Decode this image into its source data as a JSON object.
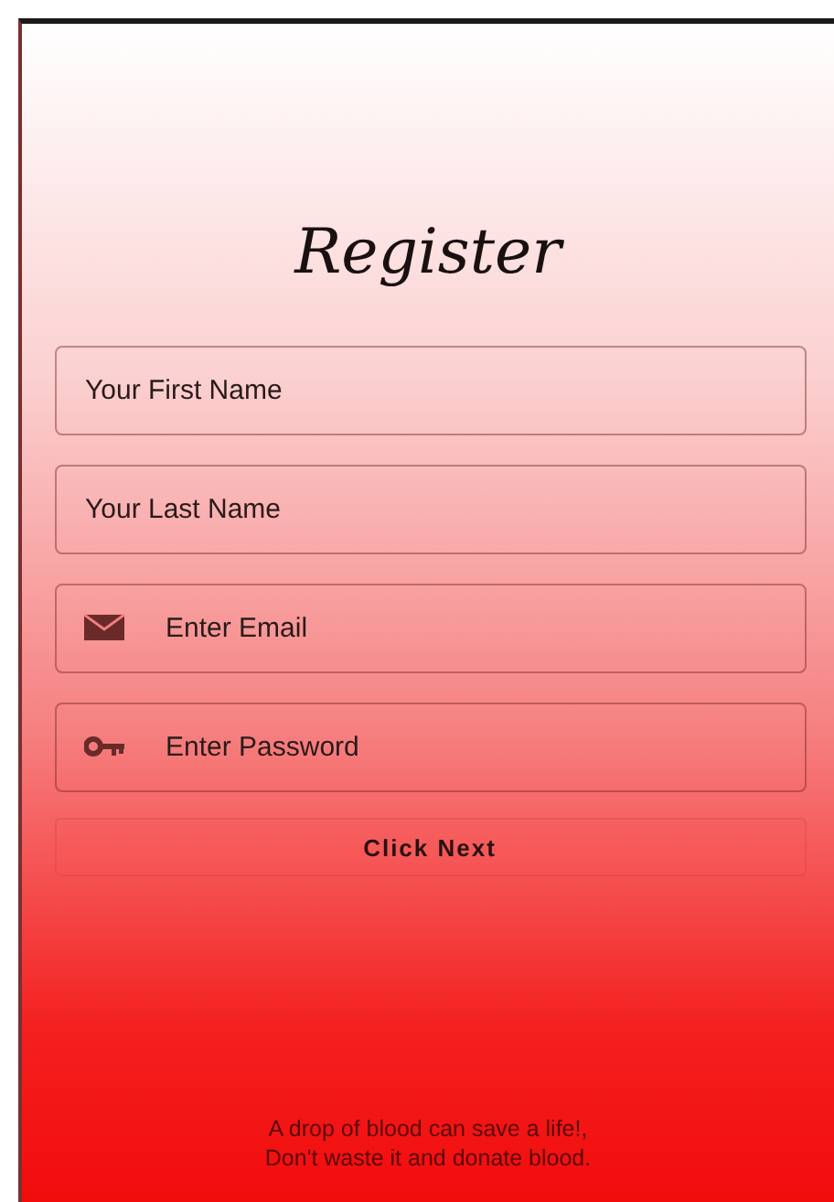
{
  "title": "Register",
  "fields": [
    {
      "kind": "text",
      "placeholder": "Your First Name"
    },
    {
      "kind": "text",
      "placeholder": "Your Last Name"
    },
    {
      "kind": "email",
      "placeholder": "Enter Email"
    },
    {
      "kind": "password",
      "placeholder": "Enter Password"
    }
  ],
  "button": "Click Next",
  "footer_lines": [
    "A drop of blood can save a life!,",
    "Don't waste it and donate blood."
  ]
}
